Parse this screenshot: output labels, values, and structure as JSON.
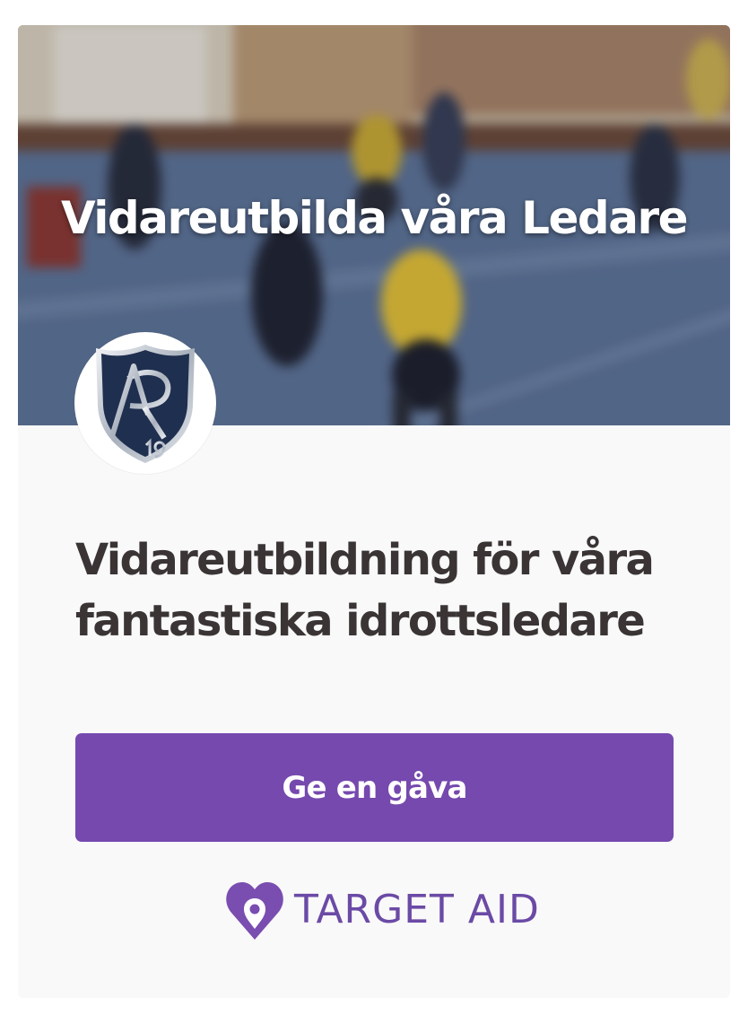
{
  "hero": {
    "title": "Vidareutbilda våra Ledare"
  },
  "campaign": {
    "headline": "Vidareutbildning för våra fantastiska idrottsledare"
  },
  "actions": {
    "give_label": "Ge en gåva"
  },
  "club_logo": {
    "text": "AR 19"
  },
  "brand": {
    "name": "TARGET AID"
  },
  "colors": {
    "accent": "#7549ae",
    "brand": "#6b4aa6",
    "headline_text": "#3a3434",
    "card_background": "#f9f9f9"
  },
  "icons": {
    "avatar": "club-shield-icon",
    "brand": "heart-location-icon"
  }
}
